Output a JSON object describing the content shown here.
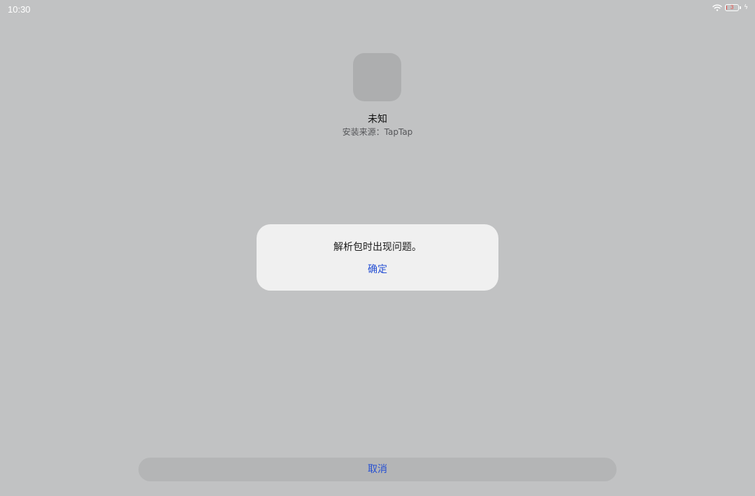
{
  "status_bar": {
    "time": "10:30",
    "battery_level": "3",
    "battery_fraction": 0.03,
    "battery_color": "#e6504a",
    "icons": [
      "wifi-icon",
      "battery-icon",
      "charging-icon"
    ]
  },
  "app": {
    "name": "未知",
    "install_source": "安装来源：TapTap",
    "icon": "app-placeholder-icon"
  },
  "dialog": {
    "message": "解析包时出现问题。",
    "confirm_label": "确定"
  },
  "footer": {
    "cancel_label": "取消"
  },
  "colors": {
    "background": "#c1c2c3",
    "dialog_background": "#f0f0f0",
    "accent": "#254fd3"
  }
}
